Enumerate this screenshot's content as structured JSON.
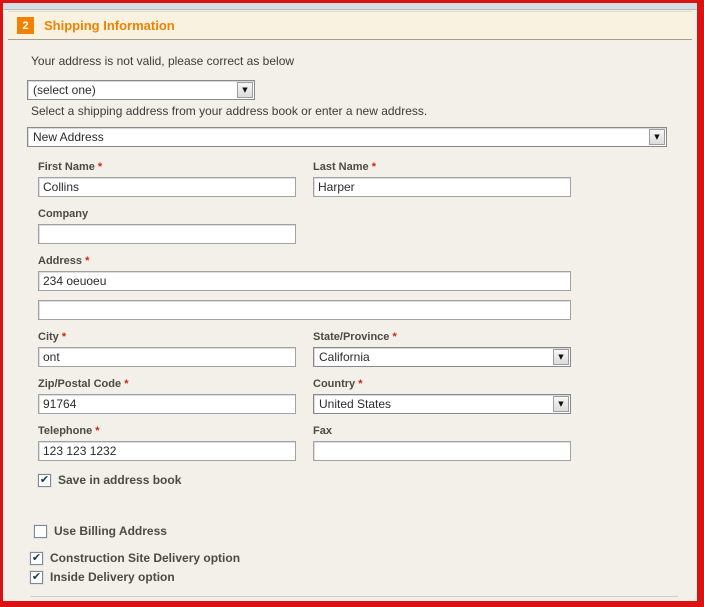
{
  "header": {
    "step_number": "2",
    "title": "Shipping Information"
  },
  "messages": {
    "invalid_address_notice": "Your address is not valid, please correct as below",
    "address_book_hint": "Select a shipping address from your address book or enter a new address."
  },
  "selects": {
    "saved_address": {
      "value": "(select one)"
    },
    "address_mode": {
      "value": "New Address"
    },
    "state": {
      "value": "California"
    },
    "country": {
      "value": "United States"
    }
  },
  "form": {
    "first_name": {
      "label": "First Name",
      "required": true,
      "value": "Collins"
    },
    "last_name": {
      "label": "Last Name",
      "required": true,
      "value": "Harper"
    },
    "company": {
      "label": "Company",
      "required": false,
      "value": ""
    },
    "address": {
      "label": "Address",
      "required": true,
      "value": "234 oeuoeu",
      "line2_value": ""
    },
    "city": {
      "label": "City",
      "required": true,
      "value": "ont"
    },
    "state": {
      "label": "State/Province",
      "required": true
    },
    "zip": {
      "label": "Zip/Postal Code",
      "required": true,
      "value": "91764"
    },
    "country": {
      "label": "Country",
      "required": true
    },
    "telephone": {
      "label": "Telephone",
      "required": true,
      "value": "123 123 1232"
    },
    "fax": {
      "label": "Fax",
      "required": false,
      "value": ""
    }
  },
  "checkboxes": {
    "save_in_address_book": {
      "label": "Save in address book",
      "checked": true
    },
    "use_billing_address": {
      "label": "Use Billing Address",
      "checked": false
    },
    "construction_site_delivery": {
      "label": "Construction Site Delivery option",
      "checked": true
    },
    "inside_delivery": {
      "label": "Inside Delivery option",
      "checked": true
    }
  },
  "marks": {
    "required": "*",
    "check": "✔",
    "dropdown_arrow": "▼"
  },
  "colors": {
    "accent_orange": "#f08200",
    "title_orange": "#ef8200",
    "frame_red": "#da1212",
    "required_red": "#d42309",
    "header_cream": "#f9f2e1",
    "body_beige": "#f3f0e9",
    "strip_gray_blue": "#d5dee3",
    "checkmark_navy": "#16375a"
  }
}
